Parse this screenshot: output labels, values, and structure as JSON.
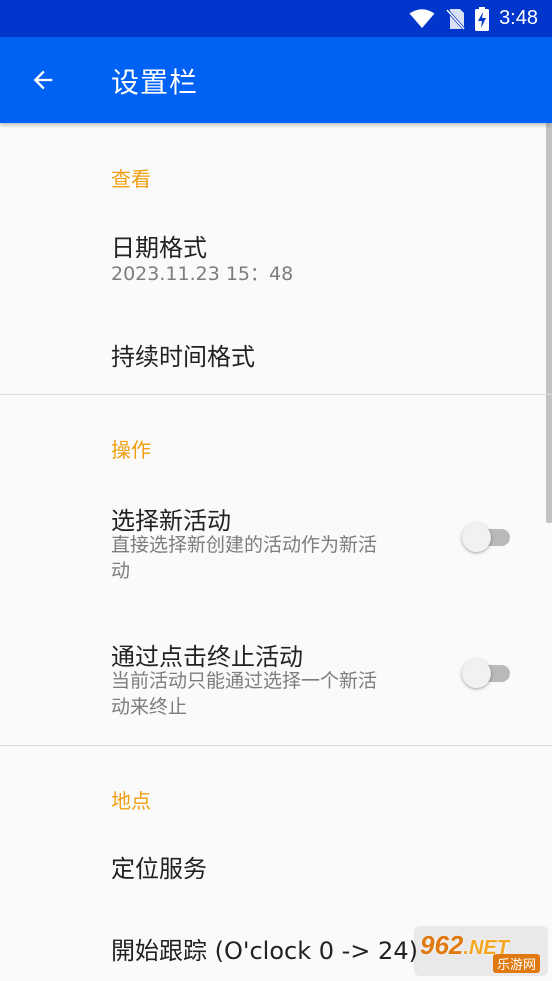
{
  "status_bar": {
    "time": "3:48"
  },
  "app_bar": {
    "title": "设置栏"
  },
  "sections": {
    "view": {
      "header": "查看",
      "date_format": {
        "title": "日期格式",
        "summary": "2023.11.23 15：48"
      },
      "duration_format": {
        "title": "持续时间格式"
      }
    },
    "actions": {
      "header": "操作",
      "select_new_activity": {
        "title": "选择新活动",
        "summary_line1": "直接选择新创建的活动作为新活",
        "summary_line2": "动",
        "enabled": false
      },
      "stop_on_click": {
        "title": "通过点击终止活动",
        "summary_line1": "当前活动只能通过选择一个新活",
        "summary_line2": "动来终止",
        "enabled": false
      }
    },
    "location": {
      "header": "地点",
      "location_service": {
        "title": "定位服务"
      },
      "start_tracking": {
        "title": "開始跟踪 (O'clock 0 -> 24)"
      }
    }
  },
  "watermark": {
    "logo": "962",
    "logo_suffix": ".NET",
    "sub": "乐游网"
  },
  "colors": {
    "app_bar": "#0062f5",
    "status_bar": "#0036cc",
    "accent": "#f0a010"
  }
}
